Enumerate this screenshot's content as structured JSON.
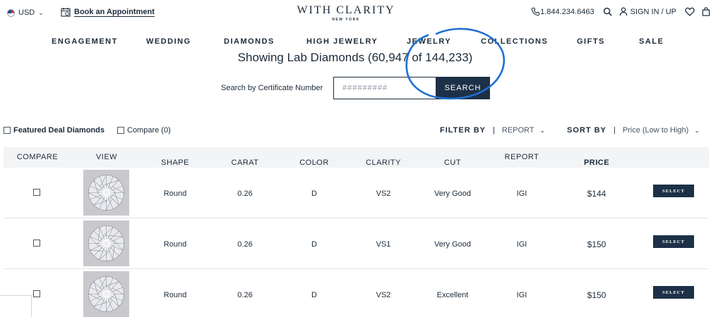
{
  "topbar": {
    "currency": "USD",
    "appointment": "Book an Appointment",
    "logo_main": "WITH CLARITY",
    "logo_sub": "NEW YORK",
    "phone": "1.844.234.6463",
    "signin": "SIGN IN / UP"
  },
  "nav": {
    "items": [
      "ENGAGEMENT",
      "WEDDING",
      "DIAMONDS",
      "HIGH JEWELRY",
      "JEWELRY",
      "COLLECTIONS",
      "GIFTS",
      "SALE"
    ]
  },
  "heading": "Showing Lab Diamonds (60,947 of 144,233)",
  "search": {
    "label": "Search by Certificate Number",
    "placeholder": "#########",
    "button": "SEARCH"
  },
  "filters": {
    "featured": "Featured Deal Diamonds",
    "compare": "Compare (0)",
    "filter_by": "FILTER BY",
    "report": "REPORT",
    "sort_by": "SORT BY",
    "sort_value": "Price (Low to High)"
  },
  "table": {
    "headers": [
      "COMPARE",
      "VIEW",
      "SHAPE",
      "CARAT",
      "COLOR",
      "CLARITY",
      "CUT",
      "REPORT",
      "PRICE"
    ],
    "select_label": "SELECT",
    "rows": [
      {
        "shape": "Round",
        "carat": "0.26",
        "color": "D",
        "clarity": "VS2",
        "cut": "Very Good",
        "report": "IGI",
        "price": "$144"
      },
      {
        "shape": "Round",
        "carat": "0.26",
        "color": "D",
        "clarity": "VS1",
        "cut": "Very Good",
        "report": "IGI",
        "price": "$150"
      },
      {
        "shape": "Round",
        "carat": "0.26",
        "color": "D",
        "clarity": "VS2",
        "cut": "Excellent",
        "report": "IGI",
        "price": "$150"
      }
    ]
  },
  "colors": {
    "navy": "#1c3147",
    "annotation": "#1f6fd1",
    "header_bg": "#f3f4f6"
  }
}
